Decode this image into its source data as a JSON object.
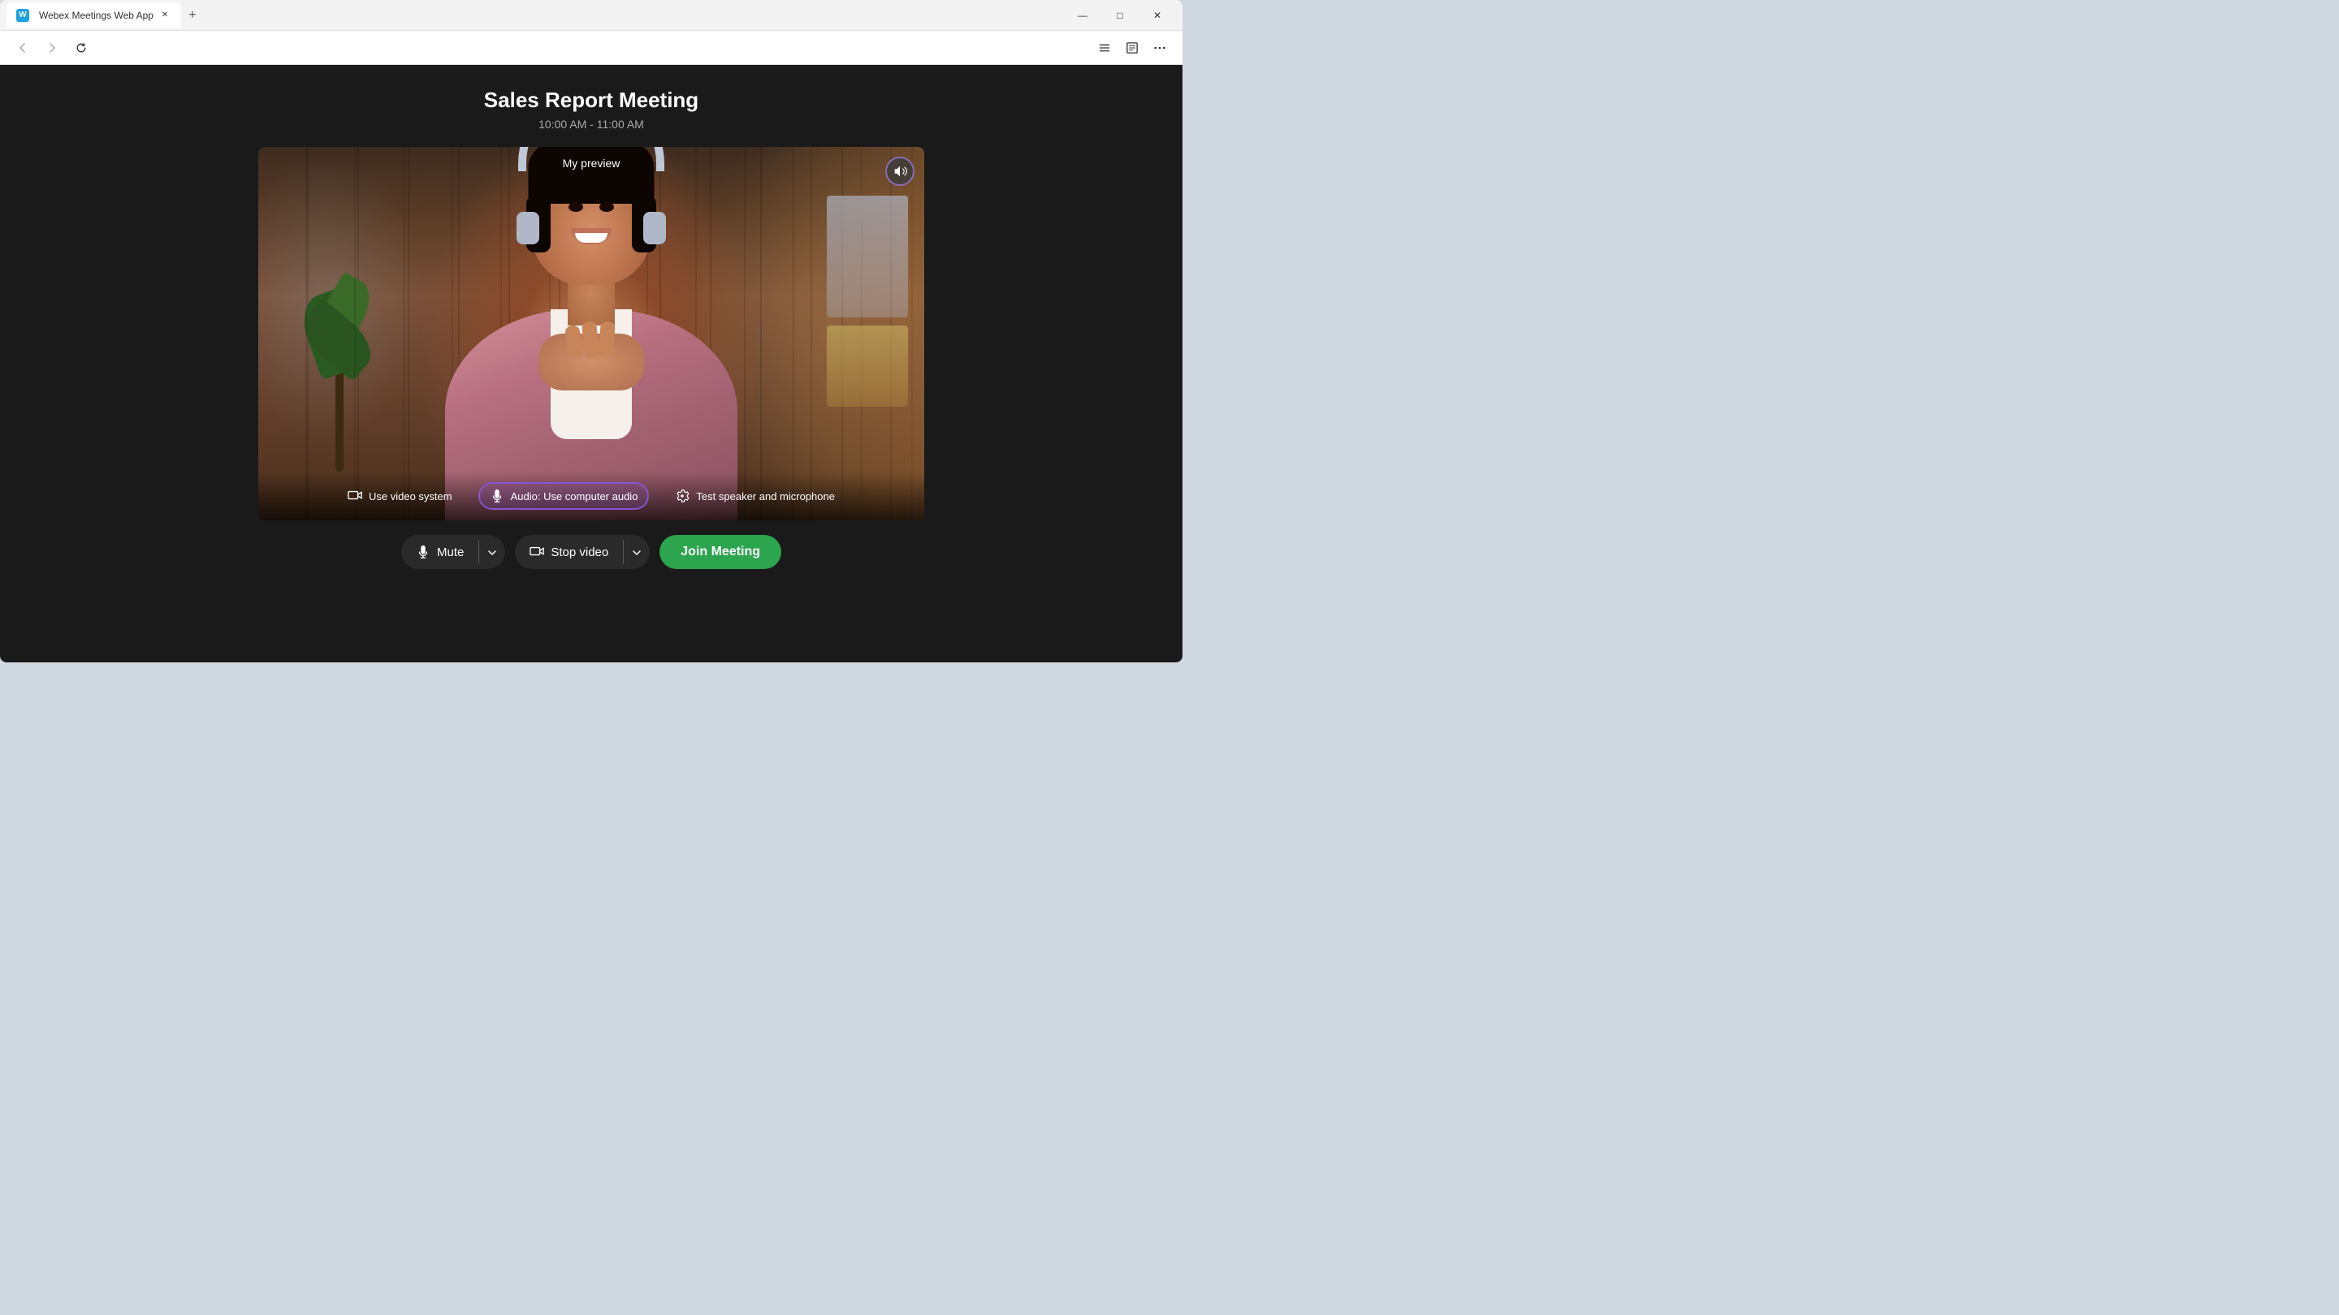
{
  "browser": {
    "tab_title": "Webex Meetings Web App",
    "favicon_letter": "W",
    "new_tab_symbol": "+",
    "controls": {
      "minimize": "—",
      "maximize": "□",
      "close": "✕"
    }
  },
  "nav": {
    "back_title": "Back",
    "forward_title": "Forward",
    "reload_title": "Reload"
  },
  "meeting": {
    "title": "Sales Report Meeting",
    "time": "10:00 AM - 11:00 AM",
    "preview_label": "My preview"
  },
  "controls": {
    "audio_option_1": "Use video system",
    "audio_option_2": "Audio: Use computer audio",
    "audio_option_3": "Test speaker and microphone",
    "mute_label": "Mute",
    "stop_video_label": "Stop video",
    "join_label": "Join Meeting"
  },
  "colors": {
    "join_green": "#2da44e",
    "audio_purple": "#8855cc",
    "dark_bg": "#1a1a1a"
  }
}
